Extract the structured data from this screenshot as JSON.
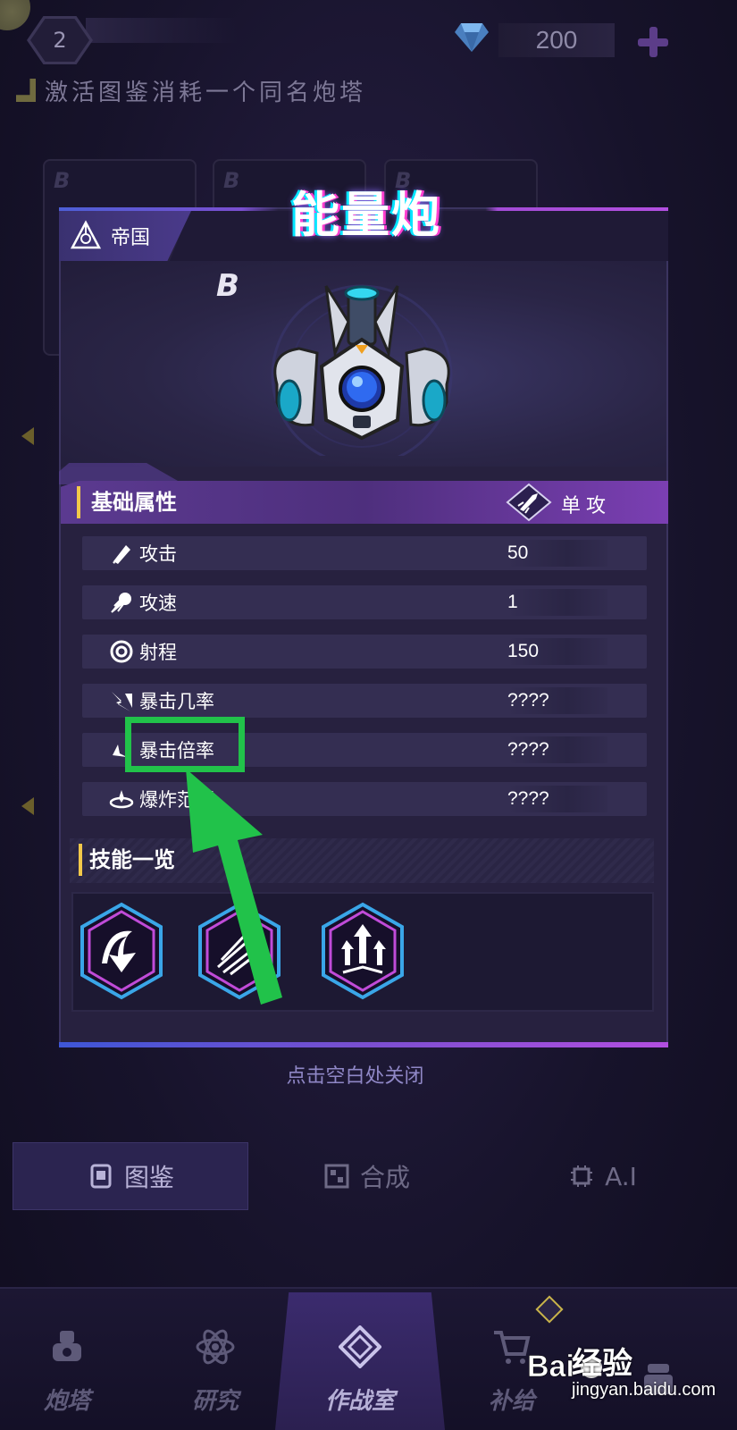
{
  "header": {
    "level": "2",
    "gem_count": "200",
    "gem_color": "#5fa6e8"
  },
  "notice": "激活图鉴消耗一个同名炮塔",
  "background_cards": [
    {
      "rank": "B"
    },
    {
      "rank": "B"
    },
    {
      "rank": "B"
    }
  ],
  "modal": {
    "faction": "帝国",
    "title": "能量炮",
    "rank": "B",
    "section_title": "基础属性",
    "attack_type": "单攻",
    "stats": [
      {
        "label": "攻击",
        "value": "50",
        "icon": "attack-icon"
      },
      {
        "label": "攻速",
        "value": "1",
        "icon": "attack-speed-icon"
      },
      {
        "label": "射程",
        "value": "150",
        "icon": "range-icon"
      },
      {
        "label": "暴击几率",
        "value": "????",
        "icon": "crit-chance-icon"
      },
      {
        "label": "暴击倍率",
        "value": "????",
        "icon": "crit-multiplier-icon"
      },
      {
        "label": "爆炸范围",
        "value": "????",
        "icon": "explosion-radius-icon"
      }
    ],
    "skills_title": "技能一览",
    "skills": [
      {
        "icon": "skill-arc-strike-icon"
      },
      {
        "icon": "skill-slash-icon"
      },
      {
        "icon": "skill-upgrade-arrows-icon"
      }
    ],
    "close_hint": "点击空白处关闭"
  },
  "tabs": [
    {
      "label": "图鉴",
      "icon": "codex-icon",
      "active": true
    },
    {
      "label": "合成",
      "icon": "synthesis-icon",
      "active": false
    },
    {
      "label": "A.I",
      "icon": "ai-chip-icon",
      "active": false
    }
  ],
  "bottom_nav": [
    {
      "label": "炮塔",
      "icon": "tower-icon"
    },
    {
      "label": "研究",
      "icon": "atom-icon"
    },
    {
      "label": "作战室",
      "icon": "war-room-icon"
    },
    {
      "label": "补给",
      "icon": "cart-icon"
    },
    {
      "label": "",
      "icon": "hero-icon"
    }
  ],
  "annotation": {
    "highlight_color": "#21c24a"
  },
  "watermark": {
    "brand": "经验",
    "url": "jingyan.baidu.com"
  }
}
